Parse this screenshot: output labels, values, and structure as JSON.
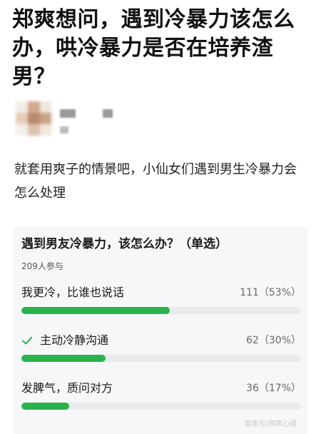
{
  "article": {
    "title": "郑爽想问，遇到冷暴力该怎么办，哄冷暴力是否在培养渣男？",
    "intro": "就套用爽子的情景吧，小仙女们遇到男生冷暴力会怎么处理"
  },
  "poll": {
    "question": "遇到男友冷暴力，该怎么办？（单选）",
    "participants": "209人参与",
    "options": [
      {
        "label": "我更冷，比谁也说话",
        "stat": "111（53%）",
        "percent": 53,
        "selected": false
      },
      {
        "label": "主动冷静沟通",
        "stat": "62（30%）",
        "percent": 30,
        "selected": true
      },
      {
        "label": "发脾气，质问对方",
        "stat": "36（17%）",
        "percent": 17,
        "selected": false
      }
    ]
  },
  "colors": {
    "accent": "#2bb24c",
    "track": "#e9eaec",
    "card_bg": "#f6f7f8"
  },
  "icons": {
    "selected_option": "check-icon"
  },
  "watermark": "百家号/郑爽心语"
}
